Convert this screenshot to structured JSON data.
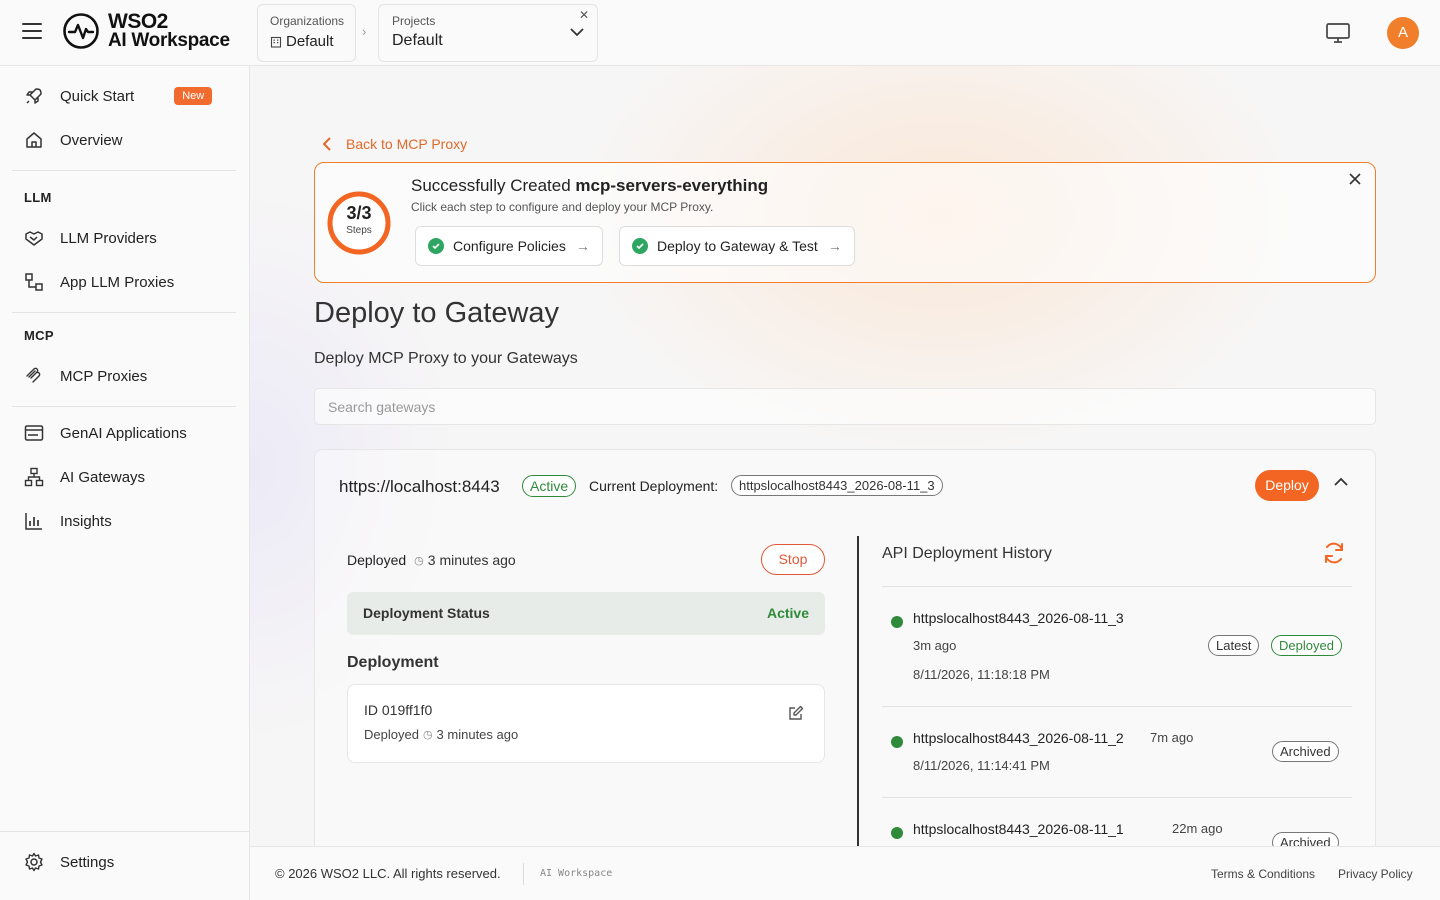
{
  "header": {
    "logo_line1": "WSO2",
    "logo_line2": "AI Workspace",
    "org_caption": "Organizations",
    "org_value": "Default",
    "project_caption": "Projects",
    "project_value": "Default",
    "avatar_initial": "A"
  },
  "sidebar": {
    "items": [
      {
        "label": "Quick Start",
        "icon": "rocket-icon",
        "badge": "New"
      },
      {
        "label": "Overview",
        "icon": "home-icon"
      },
      {
        "label": "LLM Providers",
        "icon": "handshake-icon"
      },
      {
        "label": "App LLM Proxies",
        "icon": "proxy-icon"
      },
      {
        "label": "MCP Proxies",
        "icon": "mcp-icon"
      },
      {
        "label": "GenAI Applications",
        "icon": "app-window-icon"
      },
      {
        "label": "AI Gateways",
        "icon": "network-icon"
      },
      {
        "label": "Insights",
        "icon": "bar-chart-icon"
      },
      {
        "label": "Settings",
        "icon": "gear-icon"
      }
    ],
    "sections": {
      "llm": "LLM",
      "mcp": "MCP"
    }
  },
  "main": {
    "back_label": "Back to MCP Proxy",
    "stepper": {
      "count": "3/3",
      "count_caption": "Steps",
      "progress": 1.0,
      "title_prefix": "Successfully Created",
      "title_name": "mcp-servers-everything",
      "subtitle": "Click each step to configure and deploy your MCP Proxy.",
      "steps": [
        {
          "label": "Configure Policies",
          "status": "done"
        },
        {
          "label": "Deploy to Gateway & Test",
          "status": "done"
        }
      ]
    },
    "title": "Deploy to Gateway",
    "subtitle": "Deploy MCP Proxy to your Gateways",
    "search_placeholder": "Search gateways",
    "gateway": {
      "url": "https://localhost:8443",
      "status": "Active",
      "current_deployment_label": "Current Deployment:",
      "current_deployment": "httpslocalhost8443_2026-08-11_3",
      "deploy_label": "Deploy",
      "deployed_label": "Deployed",
      "deployed_ago": "3 minutes ago",
      "stop_label": "Stop",
      "deployment_status_label": "Deployment Status",
      "deployment_status_value": "Active",
      "deployment_heading": "Deployment",
      "deployment_id": "ID 019ff1f0",
      "deployment_meta_label": "Deployed",
      "deployment_meta_ago": "3 minutes ago",
      "history_title": "API Deployment History",
      "history": [
        {
          "name": "httpslocalhost8443_2026-08-11_3",
          "ago": "3m ago",
          "datetime": "8/11/2026, 11:18:18 PM",
          "chips": [
            "Latest",
            "Deployed"
          ]
        },
        {
          "name": "httpslocalhost8443_2026-08-11_2",
          "ago": "7m ago",
          "datetime": "8/11/2026, 11:14:41 PM",
          "chips": [
            "Archived"
          ]
        },
        {
          "name": "httpslocalhost8443_2026-08-11_1",
          "ago": "22m ago",
          "datetime": "",
          "chips": [
            "Archived"
          ]
        }
      ]
    }
  },
  "footer": {
    "copyright": "© 2026 WSO2 LLC. All rights reserved.",
    "product": "AI Workspace",
    "terms": "Terms & Conditions",
    "privacy": "Privacy Policy"
  },
  "colors": {
    "accent": "#f26522",
    "success": "#2f8a3a",
    "danger": "#e05a3a"
  }
}
